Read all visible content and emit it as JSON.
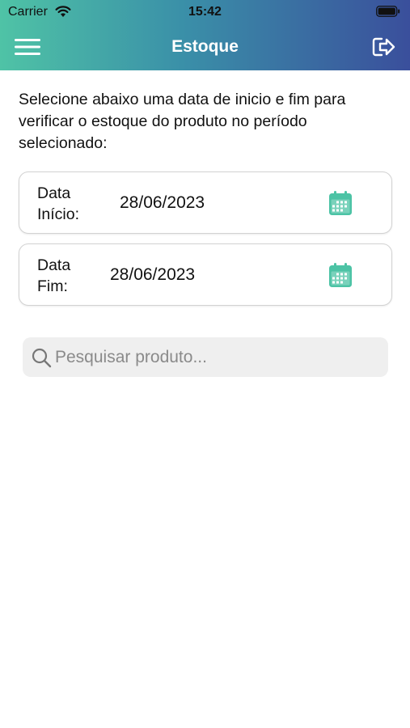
{
  "status_bar": {
    "carrier": "Carrier",
    "time": "15:42"
  },
  "nav": {
    "title": "Estoque",
    "menu_icon": "hamburger-menu-icon",
    "logout_icon": "logout-icon"
  },
  "instructions": "Selecione abaixo uma data de inicio e fim para verificar o estoque do produto no período selecionado:",
  "date_start": {
    "label_line1": "Data",
    "label_line2": "Início:",
    "value": "28/06/2023",
    "icon": "calendar-icon"
  },
  "date_end": {
    "label_line1": "Data",
    "label_line2": "Fim:",
    "value": "28/06/2023",
    "icon": "calendar-icon"
  },
  "search": {
    "placeholder": "Pesquisar produto...",
    "value": ""
  },
  "colors": {
    "header_gradient_start": "#4fc3a6",
    "header_gradient_end": "#3a4f9c",
    "accent": "#4cc3a5",
    "search_background": "#efefef"
  }
}
